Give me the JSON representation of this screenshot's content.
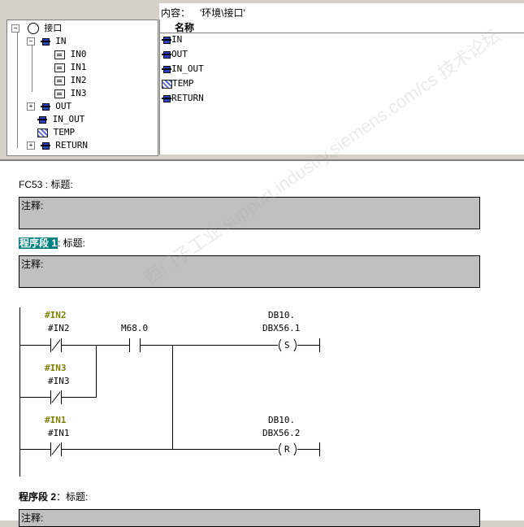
{
  "right_header": {
    "label": "内容：",
    "path": "'环境\\接口'"
  },
  "col_name": "名称",
  "tree": {
    "root": "接口",
    "in": "IN",
    "in_children": [
      "IN0",
      "IN1",
      "IN2",
      "IN3"
    ],
    "out": "OUT",
    "in_out": "IN_OUT",
    "temp": "TEMP",
    "return": "RETURN",
    "root_toggle": "−",
    "in_toggle": "−",
    "out_toggle": "+",
    "return_toggle": "+"
  },
  "list": [
    "IN",
    "OUT",
    "IN_OUT",
    "TEMP",
    "RETURN"
  ],
  "editor": {
    "block_title": "FC53 : 标题:",
    "comment_label": "注释:",
    "seg1_label": "程序段 1",
    "seg_title": ": 标题:",
    "seg2_label": "程序段 2",
    "seg2_title": "：标题:",
    "watermark": "西门子工业 support.industry.siemens.com/cs 技术论坛"
  },
  "ladder": {
    "in2_sym": "#IN2",
    "in2": "#IN2",
    "in3_sym": "#IN3",
    "in3": "#IN3",
    "in1_sym": "#IN1",
    "in1": "#IN1",
    "m_contact": "M68.0",
    "coil1_db": "DB10.",
    "coil1_addr": "DBX56.1",
    "coil1_type": "S",
    "coil2_db": "DB10.",
    "coil2_addr": "DBX56.2",
    "coil2_type": "R"
  },
  "colors": {
    "accent": "#008080",
    "symbol": "#808000",
    "comment_bg": "#c0c0c0",
    "icon_blue": "#2b3fbf"
  }
}
